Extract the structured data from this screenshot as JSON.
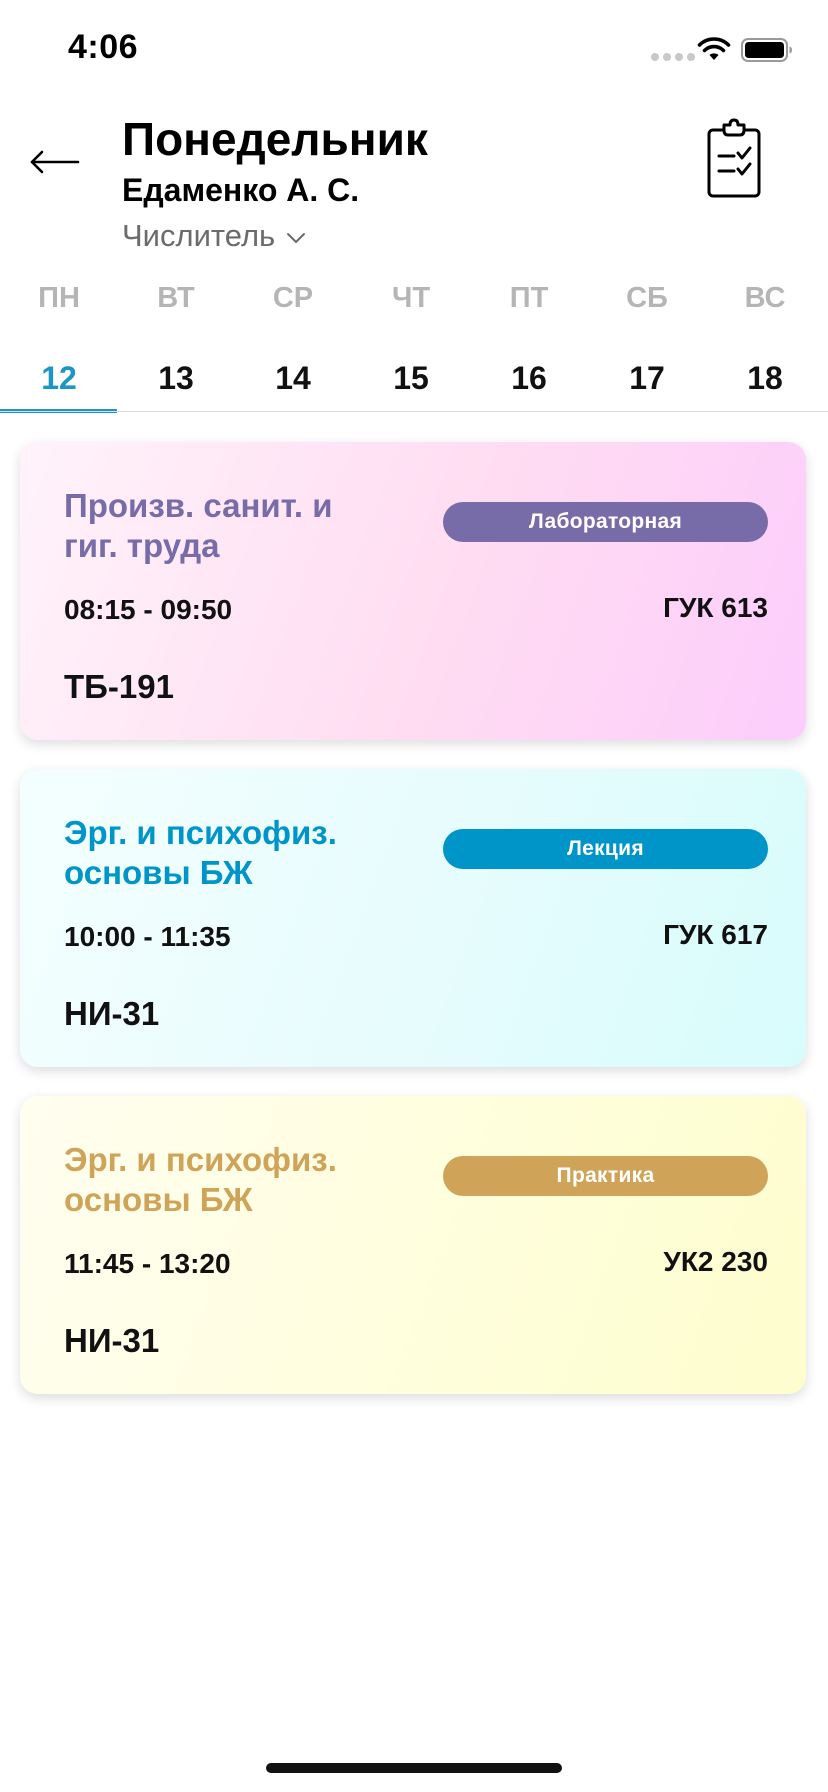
{
  "status_bar": {
    "time": "4:06"
  },
  "header": {
    "title": "Понедельник",
    "teacher": "Едаменко А. С.",
    "week_type": "Числитель"
  },
  "icons": {
    "back": "arrow-left-icon",
    "clipboard": "clipboard-checklist-icon",
    "chevron": "chevron-down-icon",
    "wifi": "wifi-icon",
    "battery": "battery-icon",
    "signal": "signal-icon"
  },
  "days": [
    {
      "name": "ПН",
      "number": "12",
      "active": true
    },
    {
      "name": "ВТ",
      "number": "13",
      "active": false
    },
    {
      "name": "СР",
      "number": "14",
      "active": false
    },
    {
      "name": "ЧТ",
      "number": "15",
      "active": false
    },
    {
      "name": "ПТ",
      "number": "16",
      "active": false
    },
    {
      "name": "СБ",
      "number": "17",
      "active": false
    },
    {
      "name": "ВС",
      "number": "18",
      "active": false
    }
  ],
  "colors": {
    "accent": "#1a97c6",
    "lab": "#776ca8",
    "lecture": "#0095c8",
    "practice": "#cfa458"
  },
  "lessons": [
    {
      "title": "Произв. санит. и гиг. труда",
      "type": "Лабораторная",
      "time": "08:15 - 09:50",
      "room": "ГУК 613",
      "group": "ТБ-191",
      "color": "#776ca8"
    },
    {
      "title": "Эрг. и психофиз. основы БЖ",
      "type": "Лекция",
      "time": "10:00 - 11:35",
      "room": "ГУК 617",
      "group": "НИ-31",
      "color": "#0095c8"
    },
    {
      "title": "Эрг. и психофиз. основы БЖ",
      "type": "Практика",
      "time": "11:45 - 13:20",
      "room": "УК2 230",
      "group": "НИ-31",
      "color": "#cfa458"
    }
  ]
}
